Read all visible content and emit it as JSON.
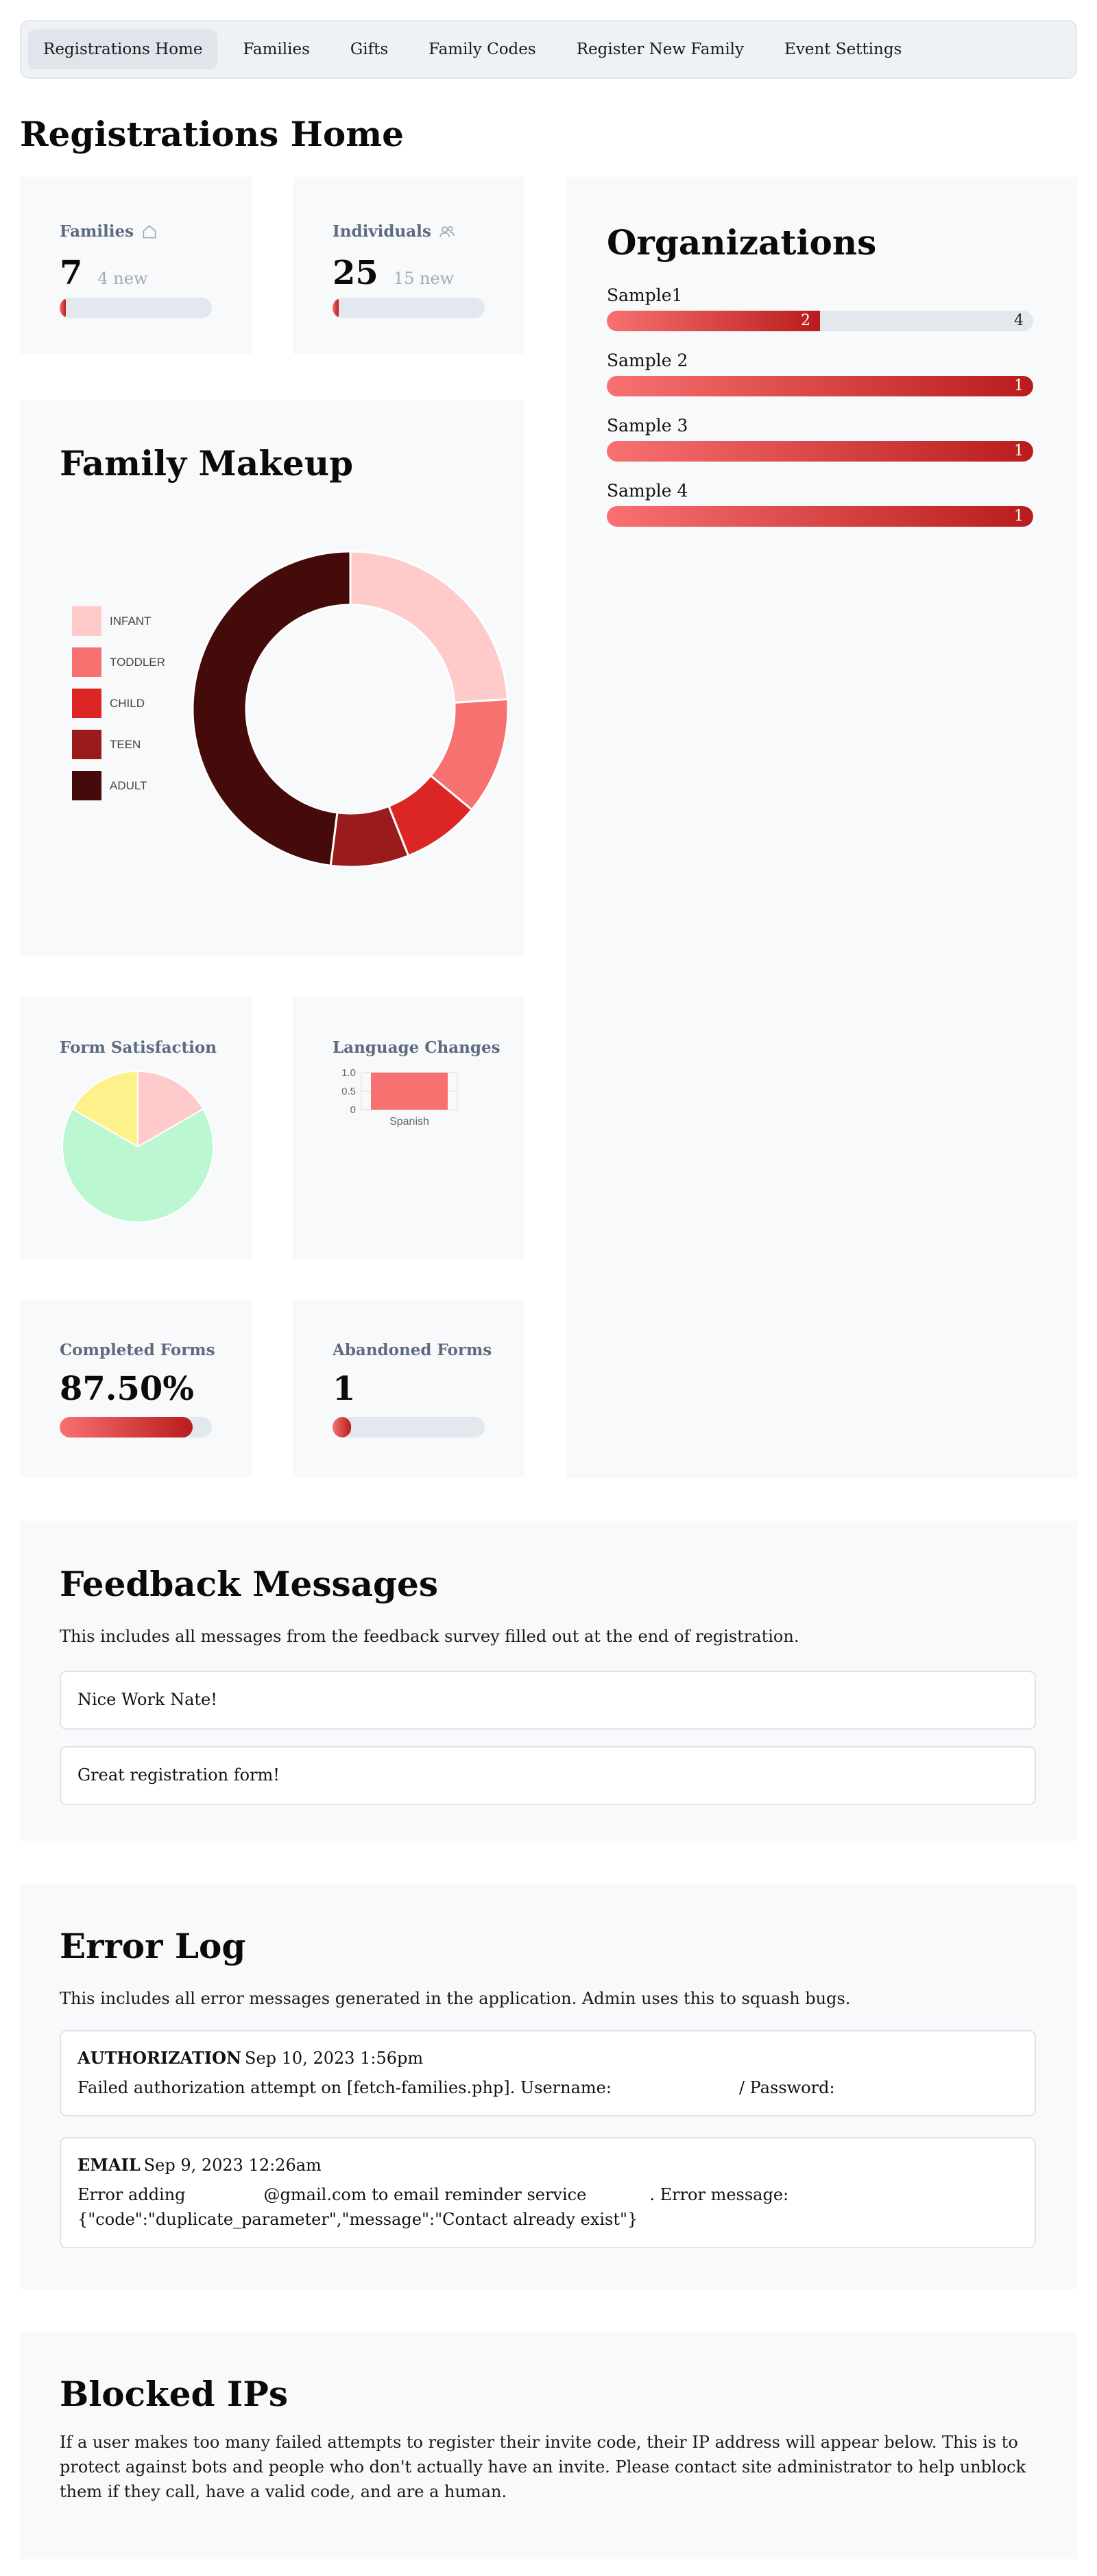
{
  "nav": {
    "items": [
      {
        "label": "Registrations Home"
      },
      {
        "label": "Families"
      },
      {
        "label": "Gifts"
      },
      {
        "label": "Family Codes"
      },
      {
        "label": "Register New Family"
      },
      {
        "label": "Event Settings"
      }
    ]
  },
  "page_title": "Registrations Home",
  "stats": {
    "families": {
      "label": "Families",
      "icon": "house-icon",
      "value": "7",
      "sub": "4 new",
      "progress": 0.04
    },
    "individuals": {
      "label": "Individuals",
      "icon": "users-icon",
      "value": "25",
      "sub": "15 new",
      "progress": 0.04
    }
  },
  "organizations": {
    "title": "Organizations",
    "items": [
      {
        "name": "Sample1",
        "value": "2",
        "total": "4",
        "fraction": 0.5
      },
      {
        "name": "Sample 2",
        "value": "1",
        "total": "",
        "fraction": 1
      },
      {
        "name": "Sample 3",
        "value": "1",
        "total": "",
        "fraction": 1
      },
      {
        "name": "Sample 4",
        "value": "1",
        "total": "",
        "fraction": 1
      }
    ]
  },
  "family_makeup": {
    "title": "Family Makeup",
    "legend": [
      "INFANT",
      "TODDLER",
      "CHILD",
      "TEEN",
      "ADULT"
    ]
  },
  "form_satisfaction": {
    "title": "Form Satisfaction"
  },
  "language_changes": {
    "title": "Language Changes"
  },
  "completed_forms": {
    "title": "Completed Forms",
    "value": "87.50%",
    "progress": 0.875
  },
  "abandoned_forms": {
    "title": "Abandoned Forms",
    "value": "1",
    "progress": 0.12
  },
  "feedback": {
    "title": "Feedback Messages",
    "description": "This includes all messages from the feedback survey filled out at the end of registration.",
    "messages": [
      "Nice Work Nate!",
      "Great registration form!"
    ]
  },
  "error_log": {
    "title": "Error Log",
    "description": "This includes all error messages generated in the application. Admin uses this to squash bugs.",
    "entries": [
      {
        "type": "AUTHORIZATION",
        "date": "Sep 10, 2023 1:56pm",
        "body_a": "Failed authorization attempt on [fetch-families.php]. Username:",
        "body_b": "/ Password:"
      },
      {
        "type": "EMAIL",
        "date": "Sep 9, 2023 12:26am",
        "body_a": "Error adding",
        "body_b": "@gmail.com to email reminder service",
        "body_c": ". Error message:",
        "body_d": "{\"code\":\"duplicate_parameter\",\"message\":\"Contact already exist\"}"
      }
    ]
  },
  "blocked_ips": {
    "title": "Blocked IPs",
    "description": "If a user makes too many failed attempts to register their invite code, their IP address will appear below. This is to protect against bots and people who don't actually have an invite. Please contact site administrator to help unblock them if they call, have a valid code, and are a human."
  },
  "colors": {
    "accent_start": "#f87171",
    "accent_end": "#b91c1c",
    "infant": "#fecaca",
    "toddler": "#f87171",
    "child": "#dc2626",
    "teen": "#991b1b",
    "adult": "#450a0a",
    "sat_pink": "#fecaca",
    "sat_green": "#bbf7d0",
    "sat_yellow": "#fef08a"
  },
  "chart_data": [
    {
      "type": "pie",
      "categories": [
        "INFANT",
        "TODDLER",
        "CHILD",
        "TEEN",
        "ADULT"
      ],
      "values": [
        6,
        3,
        2,
        2,
        12
      ],
      "donut": true,
      "legend_position": "left"
    },
    {
      "type": "pie",
      "categories": [
        "",
        "",
        ""
      ],
      "values": [
        1,
        4,
        1
      ],
      "title": "Form Satisfaction"
    },
    {
      "type": "bar",
      "categories": [
        "Spanish"
      ],
      "values": [
        1
      ],
      "ylim": [
        0,
        1
      ],
      "yticks": [
        "1.0",
        "0.5",
        "0"
      ],
      "title": "Language Changes"
    }
  ]
}
